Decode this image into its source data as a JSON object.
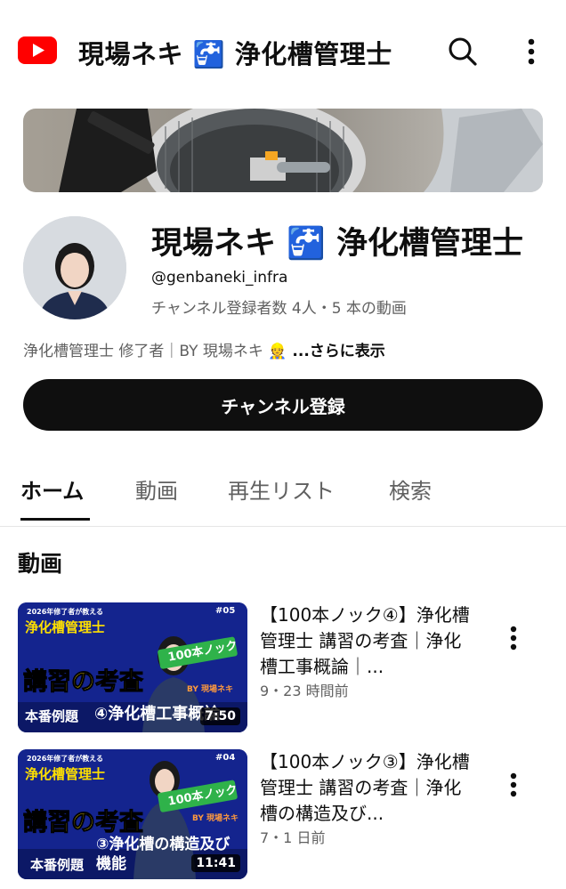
{
  "header": {
    "app_title": "現場ネキ 🚰 浄化槽管理士",
    "logo_icon": "youtube-logo-icon",
    "search_icon": "search-icon",
    "menu_icon": "more-vert-icon"
  },
  "channel": {
    "name": "現場ネキ 🚰 浄化槽管理士",
    "handle": "@genbaneki_infra",
    "stats": "チャンネル登録者数 4人・5 本の動画",
    "description": "浄化槽管理士 修了者｜BY 現場ネキ 👷",
    "more_label": " ...さらに表示",
    "subscribe_label": "チャンネル登録"
  },
  "tabs": [
    {
      "label": "ホーム",
      "active": true
    },
    {
      "label": "動画",
      "active": false
    },
    {
      "label": "再生リスト",
      "active": false
    },
    {
      "label": "検索",
      "active": false
    }
  ],
  "section": {
    "title": "動画"
  },
  "videos": [
    {
      "title": "【100本ノック④】浄化槽管理士 講習の考査｜浄化槽工事概論｜...",
      "meta": "9・23 時間前",
      "duration": "7:50",
      "thumb": {
        "tag": "#05",
        "top_caption": "2026年修了者が教える",
        "label_yellow": "浄化槽管理士",
        "big_title": "講習の考査",
        "badge": "100本ノック",
        "by": "BY 現場ネキ",
        "bottom_left": "本番例題",
        "bottom_right": "④浄化槽工事概論"
      }
    },
    {
      "title": "【100本ノック③】浄化槽管理士 講習の考査｜浄化槽の構造及び...",
      "meta": "7・1 日前",
      "duration": "11:41",
      "thumb": {
        "tag": "#04",
        "top_caption": "2026年修了者が教える",
        "label_yellow": "浄化槽管理士",
        "big_title": "講習の考査",
        "badge": "100本ノック",
        "by": "BY 現場ネキ",
        "bottom_left": "本番例題",
        "bottom_right": "③浄化槽の構造及び機能"
      }
    }
  ],
  "colors": {
    "brand_red": "#ff0000",
    "thumb_blue": "#14248e",
    "thumb_yellow": "#ffe000",
    "badge_green": "#2fb24a",
    "text_secondary": "#606060"
  }
}
